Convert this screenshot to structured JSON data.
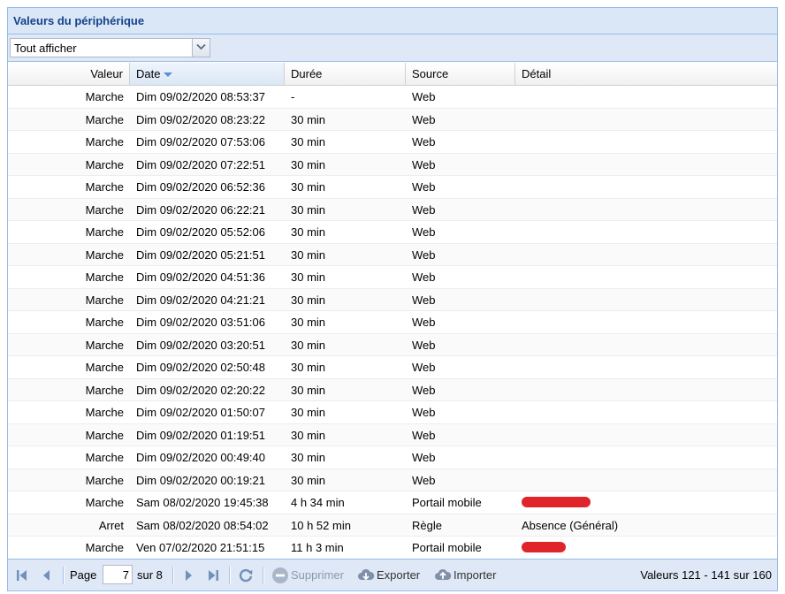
{
  "panel": {
    "title": "Valeurs du périphérique"
  },
  "filter": {
    "value": "Tout afficher"
  },
  "columns": {
    "valeur": "Valeur",
    "date": "Date",
    "duree": "Durée",
    "source": "Source",
    "detail": "Détail"
  },
  "rows": [
    {
      "valeur": "Marche",
      "date": "Dim 09/02/2020 08:53:37",
      "duree": "-",
      "source": "Web",
      "detail": ""
    },
    {
      "valeur": "Marche",
      "date": "Dim 09/02/2020 08:23:22",
      "duree": "30 min",
      "source": "Web",
      "detail": ""
    },
    {
      "valeur": "Marche",
      "date": "Dim 09/02/2020 07:53:06",
      "duree": "30 min",
      "source": "Web",
      "detail": ""
    },
    {
      "valeur": "Marche",
      "date": "Dim 09/02/2020 07:22:51",
      "duree": "30 min",
      "source": "Web",
      "detail": ""
    },
    {
      "valeur": "Marche",
      "date": "Dim 09/02/2020 06:52:36",
      "duree": "30 min",
      "source": "Web",
      "detail": ""
    },
    {
      "valeur": "Marche",
      "date": "Dim 09/02/2020 06:22:21",
      "duree": "30 min",
      "source": "Web",
      "detail": ""
    },
    {
      "valeur": "Marche",
      "date": "Dim 09/02/2020 05:52:06",
      "duree": "30 min",
      "source": "Web",
      "detail": ""
    },
    {
      "valeur": "Marche",
      "date": "Dim 09/02/2020 05:21:51",
      "duree": "30 min",
      "source": "Web",
      "detail": ""
    },
    {
      "valeur": "Marche",
      "date": "Dim 09/02/2020 04:51:36",
      "duree": "30 min",
      "source": "Web",
      "detail": ""
    },
    {
      "valeur": "Marche",
      "date": "Dim 09/02/2020 04:21:21",
      "duree": "30 min",
      "source": "Web",
      "detail": ""
    },
    {
      "valeur": "Marche",
      "date": "Dim 09/02/2020 03:51:06",
      "duree": "30 min",
      "source": "Web",
      "detail": ""
    },
    {
      "valeur": "Marche",
      "date": "Dim 09/02/2020 03:20:51",
      "duree": "30 min",
      "source": "Web",
      "detail": ""
    },
    {
      "valeur": "Marche",
      "date": "Dim 09/02/2020 02:50:48",
      "duree": "30 min",
      "source": "Web",
      "detail": ""
    },
    {
      "valeur": "Marche",
      "date": "Dim 09/02/2020 02:20:22",
      "duree": "30 min",
      "source": "Web",
      "detail": ""
    },
    {
      "valeur": "Marche",
      "date": "Dim 09/02/2020 01:50:07",
      "duree": "30 min",
      "source": "Web",
      "detail": ""
    },
    {
      "valeur": "Marche",
      "date": "Dim 09/02/2020 01:19:51",
      "duree": "30 min",
      "source": "Web",
      "detail": ""
    },
    {
      "valeur": "Marche",
      "date": "Dim 09/02/2020 00:49:40",
      "duree": "30 min",
      "source": "Web",
      "detail": ""
    },
    {
      "valeur": "Marche",
      "date": "Dim 09/02/2020 00:19:21",
      "duree": "30 min",
      "source": "Web",
      "detail": ""
    },
    {
      "valeur": "Marche",
      "date": "Sam 08/02/2020 19:45:38",
      "duree": "4 h 34 min",
      "source": "Portail mobile",
      "detail": "",
      "redacted": true
    },
    {
      "valeur": "Arret",
      "date": "Sam 08/02/2020 08:54:02",
      "duree": "10 h 52 min",
      "source": "Règle",
      "detail": "Absence (Général)"
    },
    {
      "valeur": "Marche",
      "date": "Ven 07/02/2020 21:51:15",
      "duree": "11 h 3 min",
      "source": "Portail mobile",
      "detail": "",
      "redacted": true
    }
  ],
  "pager": {
    "page_label": "Page",
    "page_value": "7",
    "of_label": "sur 8",
    "delete_label": "Supprimer",
    "export_label": "Exporter",
    "import_label": "Importer",
    "status": "Valeurs 121 - 141 sur 160"
  },
  "colors": {
    "header_bg": "#dae7f6",
    "title": "#15428b",
    "redaction": "#e0242a"
  }
}
